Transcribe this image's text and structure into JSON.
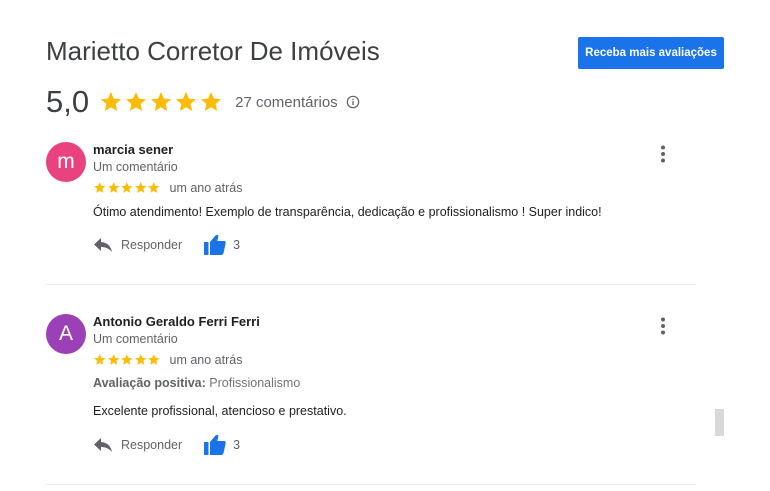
{
  "header": {
    "title": "Marietto Corretor De Imóveis",
    "cta_label": "Receba mais avaliações"
  },
  "summary": {
    "rating": "5,0",
    "stars": 5,
    "count_label": "27 comentários",
    "info_icon": "info-icon"
  },
  "colors": {
    "star": "#fbbc04",
    "accent": "#1a73e8",
    "like": "#1a73e8"
  },
  "reviews": [
    {
      "avatar_letter": "m",
      "avatar_color": "#e8437e",
      "name": "marcia sener",
      "subtitle": "Um comentário",
      "stars": 5,
      "time": "um ano atrás",
      "text": "Ótimo atendimento! Exemplo de transparência, dedicação e profissionalismo ! Super indico!",
      "reply_label": "Responder",
      "likes": "3"
    },
    {
      "avatar_letter": "A",
      "avatar_color": "#9c40b8",
      "name": "Antonio Geraldo Ferri Ferri",
      "subtitle": "Um comentário",
      "stars": 5,
      "time": "um ano atrás",
      "attribute_label": "Avaliação positiva:",
      "attribute_value": "Profissionalismo",
      "text": "Excelente profissional, atencioso e prestativo.",
      "reply_label": "Responder",
      "likes": "3"
    }
  ]
}
